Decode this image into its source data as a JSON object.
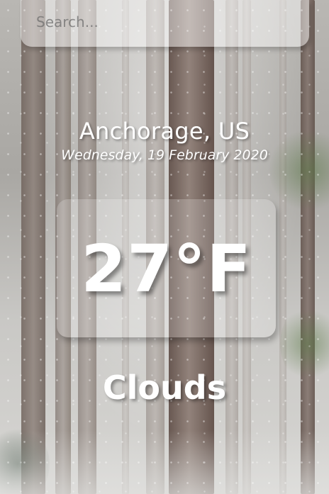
{
  "search": {
    "placeholder": "Search...",
    "value": ""
  },
  "location": {
    "city_country": "Anchorage, US",
    "date": "Wednesday, 19 February 2020"
  },
  "weather": {
    "temperature": "27°F",
    "condition": "Clouds"
  },
  "colors": {
    "text": "#ffffff",
    "search_bg": "rgba(255,255,255,0.45)",
    "temp_box_bg": "rgba(255,255,255,0.2)"
  },
  "background": {
    "scene": "snowy-forest-image"
  }
}
